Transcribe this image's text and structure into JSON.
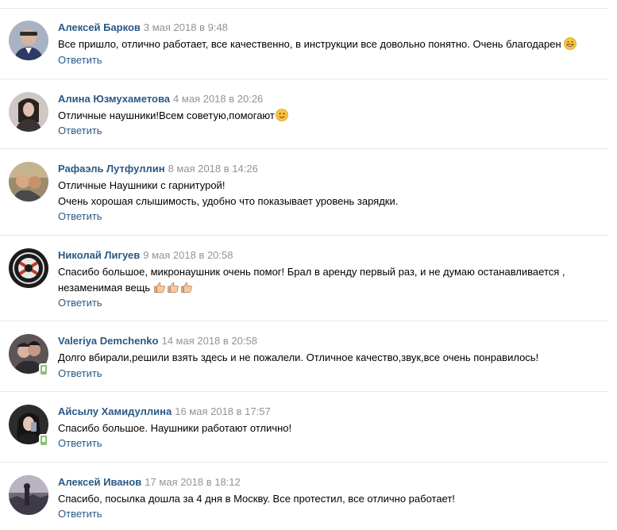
{
  "comments": [
    {
      "author": "Алексей Барков",
      "date": "3 мая 2018 в 9:48",
      "lines": [
        "Все пришло, отлично работает, все качественно, в инструкции все довольно понятно. Очень благодарен"
      ],
      "emoji": "grin",
      "reply": "Ответить",
      "online": false
    },
    {
      "author": "Алина Юзмухаметова",
      "date": "4 мая 2018 в 20:26",
      "lines": [
        "Отличные наушники!Всем советую,помогают"
      ],
      "emoji": "smile",
      "reply": "Ответить",
      "online": false
    },
    {
      "author": "Рафаэль Лутфуллин",
      "date": "8 мая 2018 в 14:26",
      "lines": [
        "Отличные Наушники с гарнитурой!",
        "Очень хорошая слышимость, удобно что показывает уровень зарядки."
      ],
      "reply": "Ответить",
      "online": false
    },
    {
      "author": "Николай Лигуев",
      "date": "9 мая 2018 в 20:58",
      "lines": [
        "Спасибо большое, микронаушник очень помог! Брал в аренду первый раз, и не думаю останавливается ,",
        "незаменимая вещь"
      ],
      "emoji": "thumbs-up x3",
      "reply": "Ответить",
      "online": false
    },
    {
      "author": "Valeriya Demchenko",
      "date": "14 мая 2018 в 20:58",
      "lines": [
        "Долго вбирали,решили взять здесь и не пожалели. Отличное качество,звук,все очень понравилось!"
      ],
      "reply": "Ответить",
      "online": true
    },
    {
      "author": "Айсылу Хамидуллина",
      "date": "16 мая 2018 в 17:57",
      "lines": [
        "Спасибо большое. Наушники работают отлично!"
      ],
      "reply": "Ответить",
      "online": true
    },
    {
      "author": "Алексей Иванов",
      "date": "17 мая 2018 в 18:12",
      "lines": [
        "Спасибо, посылка дошла за 4 дня в Москву. Все протестил, все отлично работает!"
      ],
      "reply": "Ответить",
      "online": false
    }
  ],
  "colors": {
    "link": "#2a5885",
    "date": "#939393",
    "divider": "#e7e8ec",
    "online": "#8ac176"
  }
}
